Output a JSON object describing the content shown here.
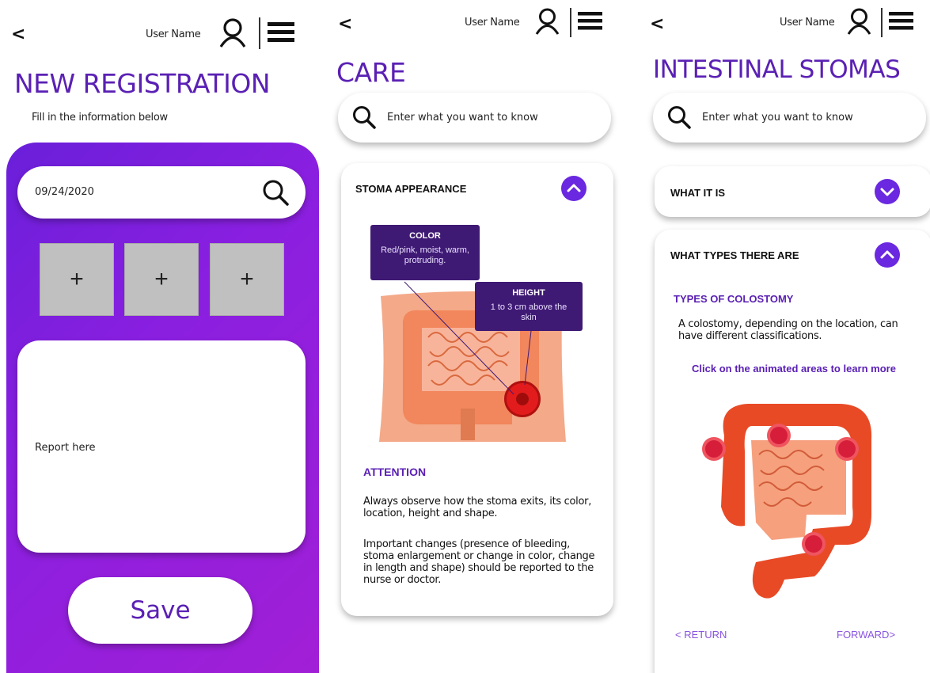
{
  "header": {
    "back_label": "<",
    "user_name": "User Name"
  },
  "icons": {
    "back": "back-chevron-icon",
    "user": "user-icon",
    "menu": "hamburger-menu-icon",
    "search": "search-icon",
    "chevron_up": "chevron-up-icon",
    "chevron_down": "chevron-down-icon"
  },
  "colors": {
    "accent": "#5a20b4",
    "panel_start": "#6a1fd9",
    "panel_end": "#a21fd6",
    "chevron": "#6a28e0",
    "tooltip": "#3f1a74",
    "tile": "#c0c0c0"
  },
  "registration": {
    "title": "NEW REGISTRATION",
    "subtitle": "Fill in the information below",
    "date_value": "09/24/2020",
    "add_buttons": [
      "+",
      "+",
      "+"
    ],
    "report_placeholder": "Report here",
    "save_label": "Save"
  },
  "care": {
    "title": "CARE",
    "search_placeholder": "Enter what you want to know",
    "section_title": "STOMA APPEARANCE",
    "tooltip_color_title": "COLOR",
    "tooltip_color_text": "Red/pink, moist, warm, protruding.",
    "tooltip_height_title": "HEIGHT",
    "tooltip_height_text": "1 to 3 cm above the skin",
    "attention_title": "ATTENTION",
    "attention_p1": "Always observe how the stoma exits, its color, location, height and shape.",
    "attention_p2": "Important changes (presence of bleeding, stoma enlargement or change in color, change in length and shape) should be reported to the nurse or doctor."
  },
  "stomas": {
    "title": "INTESTINAL STOMAS",
    "search_placeholder": "Enter what you want to know",
    "section1_title": "WHAT IT IS",
    "section2_title": "WHAT TYPES THERE ARE",
    "subtitle": "TYPES OF COLOSTOMY",
    "description": "A colostomy, depending on the location, can have different classifications.",
    "cta": "Click on the animated areas to learn more",
    "return_label": "< RETURN",
    "forward_label": "FORWARD>"
  }
}
